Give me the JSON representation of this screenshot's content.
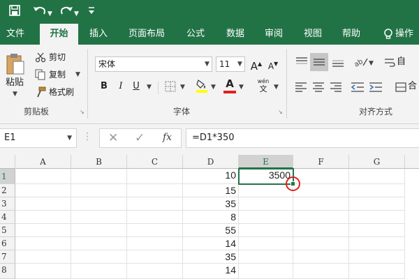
{
  "quick_access": {
    "save_icon": "save-icon",
    "undo_icon": "undo-icon",
    "redo_icon": "redo-icon",
    "customize_icon": "customize-icon"
  },
  "tabs": [
    {
      "label": "文件"
    },
    {
      "label": "开始",
      "active": true
    },
    {
      "label": "插入"
    },
    {
      "label": "页面布局"
    },
    {
      "label": "公式"
    },
    {
      "label": "数据"
    },
    {
      "label": "审阅"
    },
    {
      "label": "视图"
    },
    {
      "label": "帮助"
    },
    {
      "label": "操作"
    }
  ],
  "ribbon": {
    "clipboard": {
      "paste_label": "粘贴",
      "cut_label": "剪切",
      "copy_label": "复制",
      "format_painter_label": "格式刷",
      "group_label": "剪贴板"
    },
    "font": {
      "font_name": "宋体",
      "font_size": "11",
      "bold": "B",
      "italic": "I",
      "underline": "U",
      "increase_size": "A",
      "decrease_size": "A",
      "font_color_letter": "A",
      "phonetic": "wén",
      "group_label": "字体"
    },
    "alignment": {
      "wrap_label": "自",
      "merge_label": "合",
      "group_label": "对齐方式"
    }
  },
  "formula_bar": {
    "name_box": "E1",
    "fx_label": "fx",
    "formula": "=D1*350"
  },
  "grid": {
    "columns": [
      "A",
      "B",
      "C",
      "D",
      "E",
      "F",
      "G"
    ],
    "selected_column": "E",
    "rows": [
      {
        "row": "1",
        "D": "10",
        "E": "3500"
      },
      {
        "row": "2",
        "D": "15",
        "E": ""
      },
      {
        "row": "3",
        "D": "35",
        "E": ""
      },
      {
        "row": "4",
        "D": "8",
        "E": ""
      },
      {
        "row": "5",
        "D": "55",
        "E": ""
      },
      {
        "row": "6",
        "D": "14",
        "E": ""
      },
      {
        "row": "7",
        "D": "35",
        "E": ""
      },
      {
        "row": "8",
        "D": "14",
        "E": ""
      }
    ],
    "active_cell": "E1"
  },
  "colors": {
    "brand": "#217346",
    "highlight_circle": "#e02020",
    "font_color_bar": "#e02020",
    "fill_color_bar": "#ffff00"
  }
}
